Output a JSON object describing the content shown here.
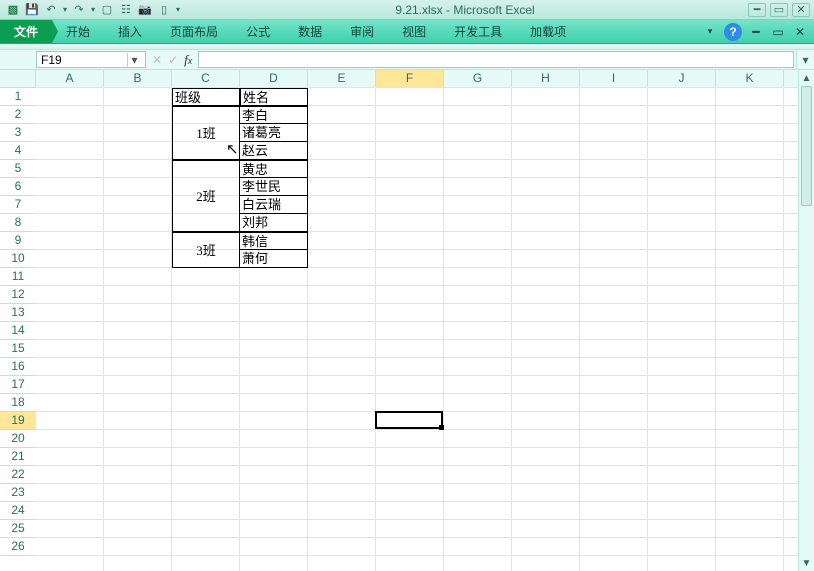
{
  "app": {
    "title": "9.21.xlsx - Microsoft Excel"
  },
  "qat": {
    "icons": [
      "excel",
      "save",
      "undo",
      "undo-dd",
      "redo",
      "redo-dd",
      "new",
      "print-area",
      "camera",
      "open",
      "more"
    ]
  },
  "ribbon": {
    "file": "文件",
    "tabs": [
      "开始",
      "插入",
      "页面布局",
      "公式",
      "数据",
      "审阅",
      "视图",
      "开发工具",
      "加载项"
    ]
  },
  "namebox": {
    "cell_ref": "F19"
  },
  "columns": [
    "A",
    "B",
    "C",
    "D",
    "E",
    "F",
    "G",
    "H",
    "I",
    "J",
    "K"
  ],
  "selected_column": "F",
  "row_count": 26,
  "selected_row": 19,
  "data": {
    "C1": "班级",
    "D1": "姓名",
    "C2": "1班",
    "D2": "李白",
    "D3": "诸葛亮",
    "D4": "赵云",
    "C5": "2班",
    "D5": "黄忠",
    "D6": "李世民",
    "D7": "白云瑞",
    "D8": "刘邦",
    "C9": "3班",
    "D9": "韩信",
    "D10": "萧何"
  },
  "active_cell": {
    "col": "F",
    "row": 19
  }
}
